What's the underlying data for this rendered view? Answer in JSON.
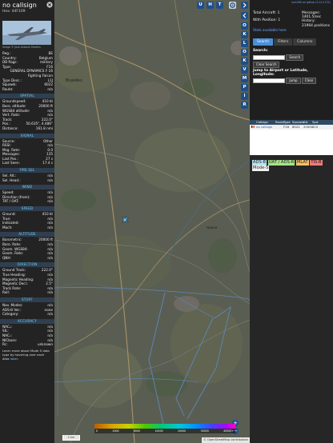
{
  "infoblock": {
    "callsign": "no callsign",
    "hex": "Hex: 44F109",
    "photo_credit": "Image © Jose Antonio Martins",
    "rows_main": [
      {
        "k": "Reg.:",
        "v": "BE"
      },
      {
        "k": "Country:",
        "v": "Belgium"
      },
      {
        "k": "DB flags:",
        "v": "military"
      },
      {
        "k": "Type:",
        "v": "F16"
      },
      {
        "k": "",
        "v": "GENERAL DYNAMICS F-16"
      },
      {
        "k": "",
        "v": "Fighting Falcon"
      },
      {
        "k": "Type Desc.:",
        "v": "L1J"
      },
      {
        "k": "Squawk:",
        "v": "6022"
      },
      {
        "k": "Route:",
        "v": "n/a"
      }
    ],
    "sections": [
      {
        "title": "SPATIAL",
        "rows": [
          {
            "k": "Groundspeed:",
            "v": "410 kt"
          },
          {
            "k": "Baro. altitude:",
            "v": "20000 ft"
          },
          {
            "k": "WGS84 altitude:",
            "v": "n/a"
          },
          {
            "k": "Vert. Rate:",
            "v": "n/a"
          },
          {
            "k": "Track:",
            "v": "222.0°"
          },
          {
            "k": "Pos.:",
            "v": "50.635°, 4.486°"
          },
          {
            "k": "Distance:",
            "v": "161.8 nmi"
          }
        ]
      },
      {
        "title": "SIGNAL",
        "rows": [
          {
            "k": "Source:",
            "v": "Other"
          },
          {
            "k": "RSSI:",
            "v": "n/a"
          },
          {
            "k": "Msg. Rate:",
            "v": "0.0"
          },
          {
            "k": "Messages:",
            "v": "135"
          },
          {
            "k": "Last Pos.:",
            "v": "27 s"
          },
          {
            "k": "Last Seen:",
            "v": "17.4 s"
          }
        ]
      },
      {
        "title": "FMS SEL",
        "rows": [
          {
            "k": "Sel. Alt.:",
            "v": "n/a"
          },
          {
            "k": "Sel. Head.:",
            "v": "n/a"
          }
        ]
      },
      {
        "title": "WIND",
        "rows": [
          {
            "k": "Speed:",
            "v": "n/a"
          },
          {
            "k": "Direction (from):",
            "v": "n/a"
          },
          {
            "k": "TAT / OAT:",
            "v": "n/a"
          }
        ]
      },
      {
        "title": "SPEED",
        "rows": [
          {
            "k": "Ground:",
            "v": "410 kt"
          },
          {
            "k": "True:",
            "v": "n/a"
          },
          {
            "k": "Indicated:",
            "v": "n/a"
          },
          {
            "k": "Mach:",
            "v": "n/a"
          }
        ]
      },
      {
        "title": "ALTITUDE",
        "rows": [
          {
            "k": "Barometric:",
            "v": "20000 ft"
          },
          {
            "k": "Baro. Rate:",
            "v": "n/a"
          },
          {
            "k": "Geom. WGS84:",
            "v": "n/a"
          },
          {
            "k": "Geom. Rate:",
            "v": "n/a"
          },
          {
            "k": "QNH:",
            "v": "n/a"
          }
        ]
      },
      {
        "title": "DIRECTION",
        "rows": [
          {
            "k": "Ground Track:",
            "v": "222.0°"
          },
          {
            "k": "True Heading:",
            "v": "n/a"
          },
          {
            "k": "Magnetic Heading:",
            "v": "n/a"
          },
          {
            "k": "Magnetic Decl.:",
            "v": "2.5°"
          },
          {
            "k": "Track Rate:",
            "v": "n/a"
          },
          {
            "k": "Roll:",
            "v": "n/a"
          }
        ]
      },
      {
        "title": "STUFF",
        "rows": [
          {
            "k": "Nav. Modes:",
            "v": "n/a"
          },
          {
            "k": "ADS-B Ver.:",
            "v": "none"
          },
          {
            "k": "Category:",
            "v": "n/a"
          }
        ]
      },
      {
        "title": "ACCURACY",
        "rows": [
          {
            "k": "NACₚ:",
            "v": "n/a"
          },
          {
            "k": "SIL:",
            "v": "n/a"
          },
          {
            "k": "NACᵥ:",
            "v": "n/a"
          },
          {
            "k": "NICbaro:",
            "v": "n/a"
          },
          {
            "k": "Rc:",
            "v": "unknown"
          }
        ]
      }
    ],
    "note_before_link": "Learn more about Mode S data type by hovering over each data ",
    "note_link": "label",
    "note_after_link": "."
  },
  "map": {
    "top_buttons": [
      "U",
      "H",
      "T"
    ],
    "side_buttons": [
      "O",
      "K",
      "L",
      "O",
      "K",
      "V",
      "M",
      "P",
      "I",
      "R"
    ],
    "scale_label": "2 km",
    "altitude_labels": [
      "0",
      "2000",
      "6000",
      "10000",
      "20000",
      "30000",
      "40000+"
    ],
    "attribution": "© OpenStreetMap contributors",
    "place_labels": [
      "Bruxelles",
      "Namur"
    ]
  },
  "sidebar": {
    "version": "tar1090 on github (3.14.1721)",
    "total_aircraft_label": "Total Aircraft:",
    "total_aircraft": "1",
    "with_position_label": "With Position:",
    "with_position": "1",
    "messages_label": "Messages:",
    "messages_value": "1401.5/sec",
    "history_label": "History:",
    "history_value": "21964 positions",
    "stats_link": "Stats available here",
    "tabs": [
      "Search",
      "Filters",
      "Columns"
    ],
    "search_label": "Search:",
    "search_button": "Search",
    "clear_button": "Clear Search",
    "jump_label": "Jump to Airport or Latitude, Longitude:",
    "jump_button": "Jump",
    "clear_small": "Clear",
    "table_headers": [
      "",
      "Callsign",
      "Route",
      "Type",
      "Squawk",
      "Alt.(ft)",
      "Spd.(kt)"
    ],
    "table_row": [
      "",
      "no callsign",
      "",
      "F16",
      "6022",
      "20000",
      "410"
    ],
    "legend": [
      "ADS-B",
      "UAT / ADS-R",
      "MLAT",
      "TIS-B",
      "Mode-S"
    ]
  }
}
